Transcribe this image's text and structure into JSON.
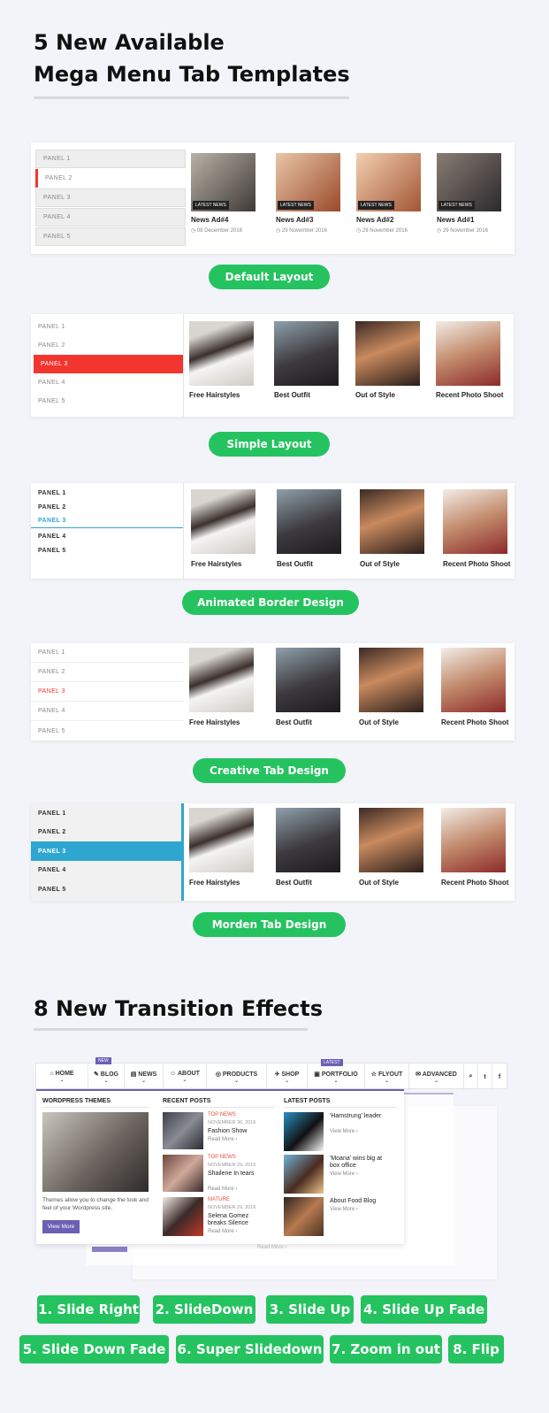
{
  "heading1": {
    "line1": "5 New Available",
    "line2": "Mega Menu Tab Templates"
  },
  "panel_labels": [
    "PANEL 1",
    "PANEL 2",
    "PANEL 3",
    "PANEL 4",
    "PANEL 5"
  ],
  "layout1": {
    "items": [
      {
        "badge": "LATEST NEWS",
        "title": "News Ad#4",
        "date": "08 December 2016"
      },
      {
        "badge": "LATEST NEWS",
        "title": "News Ad#3",
        "date": "29 November 2016"
      },
      {
        "badge": "LATEST NEWS",
        "title": "News Ad#2",
        "date": "29 November 2016"
      },
      {
        "badge": "LATEST NEWS",
        "title": "News Ad#1",
        "date": "29 November 2016"
      }
    ],
    "button": "Default Layout"
  },
  "captions": [
    "Free Hairstyles",
    "Best Outfit",
    "Out of Style",
    "Recent Photo Shoot"
  ],
  "layout2": {
    "button": "Simple Layout"
  },
  "layout3": {
    "button": "Animated Border Design"
  },
  "layout4": {
    "button": "Creative Tab Design"
  },
  "layout5": {
    "button": "Morden Tab Design"
  },
  "heading2": "8 New Transition Effects",
  "nav": {
    "items": [
      "HOME",
      "BLOG",
      "NEWS",
      "ABOUT",
      "PRODUCTS",
      "SHOP",
      "PORTFOLIO",
      "FLYOUT",
      "ADVANCED"
    ],
    "blog_badge": "NEW",
    "portfolio_badge": "LATEST"
  },
  "mega": {
    "col1": {
      "heading": "WORDPRESS THEMES",
      "text": "Themes allow you to change the look and feel of your Wordpress site.",
      "button": "View More"
    },
    "col2": {
      "heading": "RECENT POSTS",
      "posts": [
        {
          "cat": "TOP NEWS",
          "date": "NOVEMBER 30, 2016",
          "title": "Fashion Show",
          "more": "Read More ›"
        },
        {
          "cat": "TOP NEWS",
          "date": "NOVEMBER 29, 2016",
          "title": "Shailene In tears",
          "more": "Read More ›"
        },
        {
          "cat": "MATURE",
          "date": "NOVEMBER 29, 2016",
          "title": "Selena Gomez breaks Silence",
          "more": "Read More ›"
        }
      ]
    },
    "col3": {
      "heading": "LATEST POSTS",
      "posts": [
        {
          "title": "'Hamstrung' leader",
          "more": "View More ›"
        },
        {
          "title": "'Moana' wins big at box office",
          "more": "View More ›"
        },
        {
          "title": "About Food Blog",
          "more": "View More ›"
        }
      ]
    },
    "ghost": {
      "read_more": "Read More ›"
    }
  },
  "effects": [
    "1. Slide Right",
    "2. SlideDown",
    "3. Slide Up",
    "4. Slide Up Fade",
    "5. Slide Down Fade",
    "6. Super Slidedown",
    "7. Zoom in out",
    "8. Flip"
  ],
  "colors": {
    "green": "#25c360",
    "red": "#f2362f",
    "blue": "#2fa6cf",
    "purple": "#6b5fb5"
  }
}
